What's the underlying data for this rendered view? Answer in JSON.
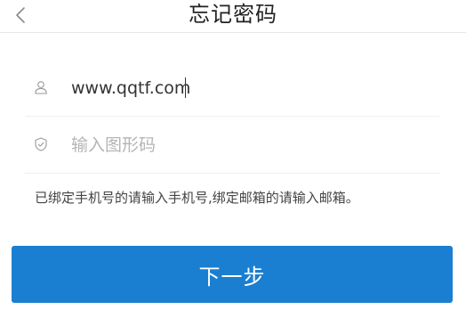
{
  "header": {
    "title": "忘记密码",
    "back_icon": "chevron-left-icon"
  },
  "form": {
    "account": {
      "value": "www.qqtf.com",
      "icon": "user-icon"
    },
    "captcha": {
      "placeholder": "输入图形码",
      "value": "",
      "icon": "shield-icon"
    },
    "hint": "已绑定手机号的请输入手机号,绑定邮箱的请输入邮箱。"
  },
  "actions": {
    "next_label": "下一步"
  },
  "colors": {
    "primary": "#1a7fd1",
    "divider": "#efefef",
    "icon": "#9a9a9a"
  }
}
